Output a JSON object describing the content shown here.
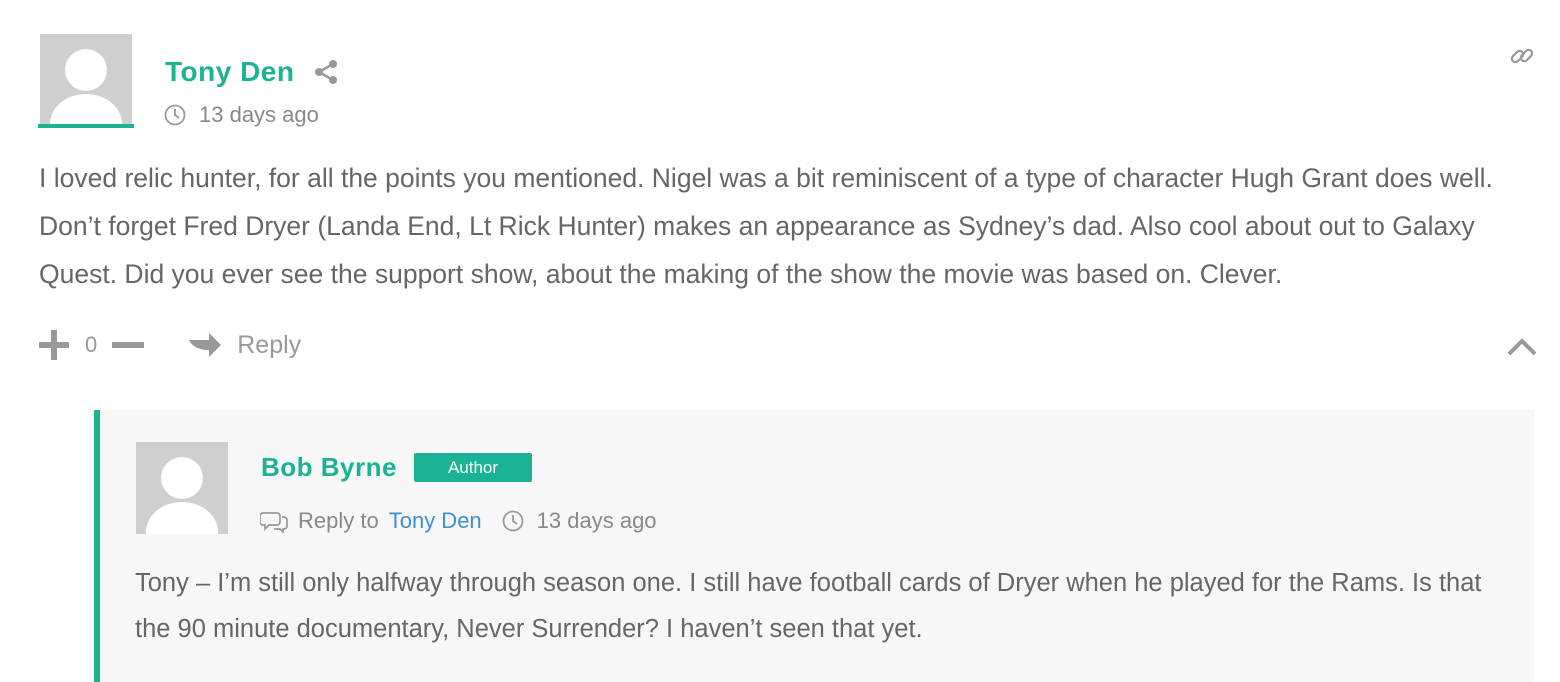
{
  "comment": {
    "author": "Tony Den",
    "time": "13 days ago",
    "text": "I loved relic hunter, for all the points you mentioned. Nigel was a bit reminiscent of a type of character Hugh Grant does well. Don’t forget Fred Dryer (Landa End, Lt Rick Hunter) makes an appearance as Sydney’s dad. Also cool about out to Galaxy Quest. Did you ever see the support show, about the making of the show the movie was based on. Clever.",
    "vote_count": "0",
    "reply_label": "Reply"
  },
  "reply": {
    "author": "Bob Byrne",
    "badge": "Author",
    "reply_to_label": "Reply to",
    "reply_to_name": "Tony Den",
    "time": "13 days ago",
    "text": "Tony – I’m still only halfway through season one. I still have football cards of Dryer when he played for the Rams. Is that the 90 minute documentary, Never Surrender? I haven’t seen that yet."
  },
  "colors": {
    "accent": "#1ab394",
    "link": "#3e8ed0",
    "text": "#666666",
    "muted": "#999999",
    "reply_bg": "#f7f7f7"
  },
  "icons": [
    "share-icon",
    "link-icon",
    "clock-icon",
    "upvote-icon",
    "downvote-icon",
    "reply-arrow-icon",
    "collapse-icon",
    "reply-to-icon"
  ]
}
